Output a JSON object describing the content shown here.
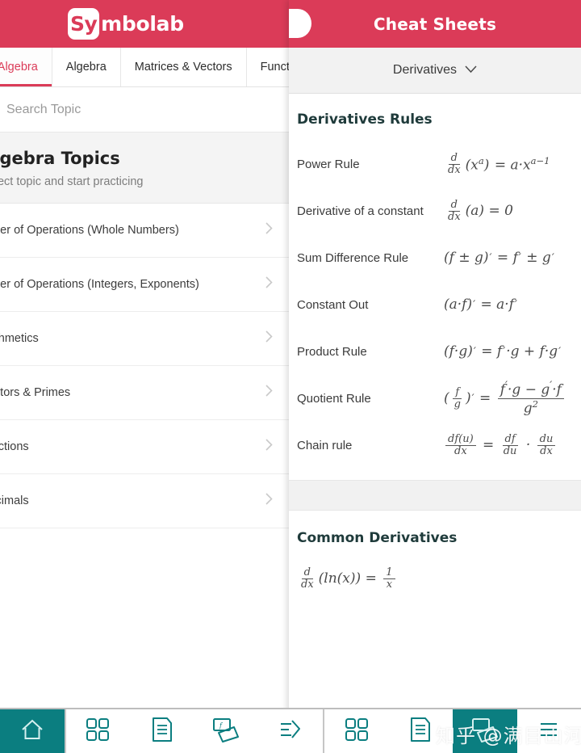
{
  "colors": {
    "brand_red": "#DB3B58",
    "teal": "#0b7e80",
    "section_heading": "#1f3b3b"
  },
  "left_panel": {
    "logo": {
      "badge": "Sy",
      "text": "mbolab"
    },
    "tabs": [
      {
        "label": "Pre Algebra",
        "active": true
      },
      {
        "label": "Algebra",
        "active": false
      },
      {
        "label": "Matrices & Vectors",
        "active": false
      },
      {
        "label": "Functions",
        "active": false
      }
    ],
    "search": {
      "placeholder": "Search Topic",
      "value": ""
    },
    "topics_header": {
      "title": "Algebra Topics",
      "subtitle": "Select topic and start practicing"
    },
    "topics": [
      {
        "label": "Order of Operations (Whole Numbers)"
      },
      {
        "label": "Order of Operations (Integers, Exponents)"
      },
      {
        "label": "Arithmetics"
      },
      {
        "label": "Factors & Primes"
      },
      {
        "label": "Fractions"
      },
      {
        "label": "Decimals"
      }
    ]
  },
  "right_panel": {
    "title": "Cheat Sheets",
    "selector": {
      "label": "Derivatives"
    },
    "rules_section": {
      "title": "Derivatives Rules",
      "rules": [
        {
          "name": "Power Rule",
          "formula": "d/dx (x^a) = a · x^(a-1)"
        },
        {
          "name": "Derivative of a constant",
          "formula": "d/dx (a) = 0"
        },
        {
          "name": "Sum Difference Rule",
          "formula": "(f ± g)' = f' ± g'"
        },
        {
          "name": "Constant Out",
          "formula": "(a · f)' = a · f'"
        },
        {
          "name": "Product Rule",
          "formula": "(f · g)' = f' · g + f · g'"
        },
        {
          "name": "Quotient Rule",
          "formula": "(f/g)' = (f' · g − g' · f) / g²"
        },
        {
          "name": "Chain rule",
          "formula": "df(u)/dx = df/du · du/dx"
        }
      ]
    },
    "common_section": {
      "title": "Common Derivatives",
      "items": [
        {
          "formula": "d/dx (ln(x)) = 1/x"
        }
      ]
    }
  },
  "bottom_bar": {
    "items": [
      {
        "icon": "home-icon",
        "selected": true
      },
      {
        "icon": "grid-icon",
        "selected": false
      },
      {
        "icon": "document-icon",
        "selected": false
      },
      {
        "icon": "flashcards-icon",
        "selected": false
      },
      {
        "icon": "share-icon",
        "selected": false
      },
      {
        "icon": "grid-icon",
        "selected": false
      },
      {
        "icon": "document-icon",
        "selected": false
      },
      {
        "icon": "flashcards-icon",
        "selected": true
      },
      {
        "icon": "menu-icon",
        "selected": false
      }
    ]
  },
  "watermark": {
    "text": "知乎 @满目山河"
  }
}
